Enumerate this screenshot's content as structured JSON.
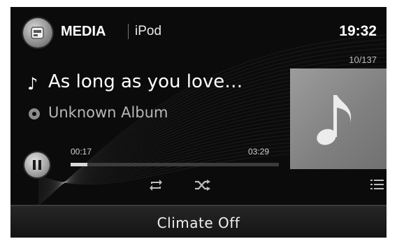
{
  "header": {
    "source_label": "MEDIA",
    "subsource_label": "iPod",
    "clock": "19:32",
    "app_icon": "media-icon"
  },
  "now_playing": {
    "track_count": "10/137",
    "title": "As long as you love…",
    "album": "Unknown Album",
    "title_icon": "music-note-icon",
    "album_icon": "disc-icon",
    "artwork_icon": "music-note-icon"
  },
  "playback": {
    "state_icon": "pause-icon",
    "elapsed": "00:17",
    "total": "03:29",
    "progress": 0.081,
    "controls": [
      "repeat-icon",
      "shuffle-icon",
      "list-icon"
    ]
  },
  "footer": {
    "climate_label": "Climate Off"
  },
  "colors": {
    "background": "#0b0b0b",
    "text": "#ffffff",
    "artwork": "#8a8a8a"
  }
}
